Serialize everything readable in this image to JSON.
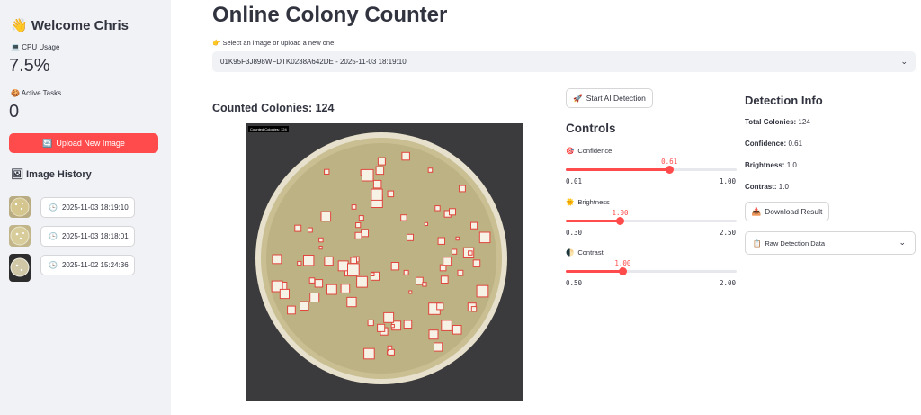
{
  "sidebar": {
    "welcome_icon": "👋",
    "welcome": "Welcome Chris",
    "cpu_icon": "💻",
    "cpu_label": "CPU Usage",
    "cpu_value": "7.5%",
    "tasks_icon": "🍪",
    "tasks_label": "Active Tasks",
    "tasks_value": "0",
    "upload_icon": "🔄",
    "upload_label": "Upload New Image",
    "history_icon": "🖼",
    "history_title": "Image History",
    "history": [
      {
        "icon": "🕒",
        "label": "2025-11-03 18:19:10"
      },
      {
        "icon": "🕒",
        "label": "2025-11-03 18:18:01"
      },
      {
        "icon": "🕒",
        "label": "2025-11-02 15:24:36"
      }
    ]
  },
  "main": {
    "title": "Online Colony Counter",
    "select_icon": "👉",
    "select_label": "Select an image or upload a new one:",
    "select_value": "01K95F3J898WFDTK0238A642DE - 2025-11-03 18:19:10",
    "counted": "Counted Colonies: 124",
    "image_tag": "Counted Colonies: 124"
  },
  "controls": {
    "ai_icon": "🚀",
    "ai_label": "Start AI Detection",
    "title": "Controls",
    "sliders": [
      {
        "icon": "🎯",
        "label": "Confidence",
        "value": "0.61",
        "min": "0.01",
        "max": "1.00",
        "fraction": 0.6061
      },
      {
        "icon": "🌞",
        "label": "Brightness",
        "value": "1.00",
        "min": "0.30",
        "max": "2.50",
        "fraction": 0.3182
      },
      {
        "icon": "🌓",
        "label": "Contrast",
        "value": "1.00",
        "min": "0.50",
        "max": "2.00",
        "fraction": 0.3333
      }
    ]
  },
  "info": {
    "title": "Detection Info",
    "total_key": "Total Colonies:",
    "total_val": "124",
    "conf_key": "Confidence:",
    "conf_val": "0.61",
    "bright_key": "Brightness:",
    "bright_val": "1.0",
    "contrast_key": "Contrast:",
    "contrast_val": "1.0",
    "download_icon": "📥",
    "download_label": "Download Result",
    "raw_icon": "📋",
    "raw_label": "Raw Detection Data"
  },
  "colors": {
    "accent": "#ff4b4b",
    "sidebar_bg": "#f0f2f6"
  }
}
